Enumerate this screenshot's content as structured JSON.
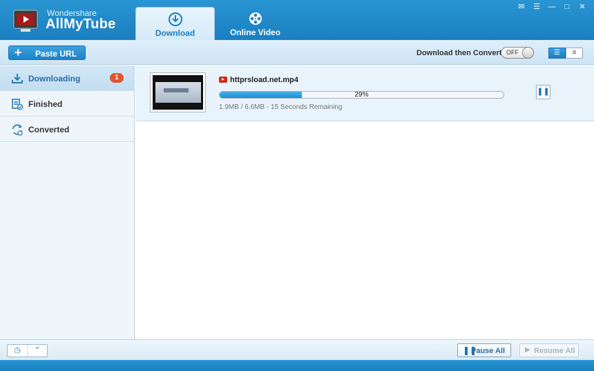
{
  "app": {
    "brand_small": "Wondershare",
    "brand_name": "AllMyTube"
  },
  "tabs": [
    {
      "label": "Download",
      "icon": "download-circle-icon",
      "active": true
    },
    {
      "label": "Online Video",
      "icon": "film-reel-icon",
      "active": false
    }
  ],
  "window_controls": [
    "chat-icon",
    "menu-icon",
    "minimize-icon",
    "maximize-icon",
    "close-icon"
  ],
  "toolbar": {
    "paste_url": "Paste URL",
    "convert_label": "Download then Convert",
    "toggle_state": "OFF",
    "view_modes": [
      "detail-list-icon",
      "compact-list-icon"
    ]
  },
  "sidebar": {
    "items": [
      {
        "label": "Downloading",
        "icon": "download-tray-icon",
        "badge": "1",
        "active": true
      },
      {
        "label": "Finished",
        "icon": "finished-file-icon",
        "active": false
      },
      {
        "label": "Converted",
        "icon": "converted-icon",
        "active": false
      }
    ]
  },
  "downloads": [
    {
      "file_name": "httprsload.net.mp4",
      "source_icon": "youtube-icon",
      "progress_fraction": 0.29,
      "progress_text": "29%",
      "status": "1.9MB / 6.6MB - 15 Seconds Remaining"
    }
  ],
  "bottom": {
    "pause_all": "Pause All",
    "resume_all": "Resume All",
    "pause_all_enabled": true,
    "resume_all_enabled": false
  },
  "colors": {
    "accent": "#1f82c6",
    "badge": "#e0552b",
    "progress": "#1790d4"
  }
}
